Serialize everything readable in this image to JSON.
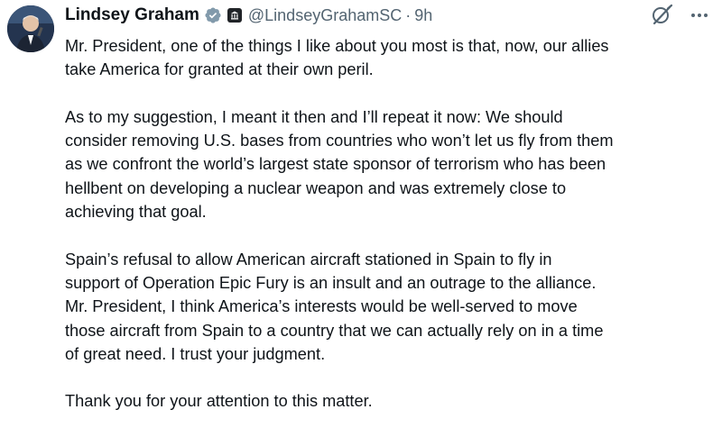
{
  "author": {
    "display_name": "Lindsey Graham",
    "handle": "@LindseyGrahamSC",
    "separator": "·",
    "time": "9h"
  },
  "icons": {
    "verified": "verified-badge-icon",
    "affiliation": "government-affiliation-icon",
    "grok": "grok-icon",
    "more": "more-options-icon"
  },
  "colors": {
    "text": "#0f1419",
    "secondary": "#536471",
    "verified_badge": "#829aab"
  },
  "tweet": {
    "paragraphs": [
      "Mr. President, one of the things I like about you most is that, now, our allies\ntake America for granted at their own peril.",
      "As to my suggestion, I meant it then and I’ll repeat it now: We should\nconsider removing U.S. bases from countries who won’t let us fly from them\nas we confront the world’s largest state sponsor of terrorism who has been\nhellbent on developing a nuclear weapon and was extremely close to\nachieving that goal.",
      "Spain’s refusal to allow American aircraft stationed in Spain to fly in\nsupport of Operation Epic Fury is an insult and an outrage to the alliance.\nMr. President, I think America’s interests would be well-served to move\nthose aircraft from Spain to a country that we can actually rely on in a time\nof great need. I trust your judgment.",
      "Thank you for your attention to this matter."
    ]
  }
}
